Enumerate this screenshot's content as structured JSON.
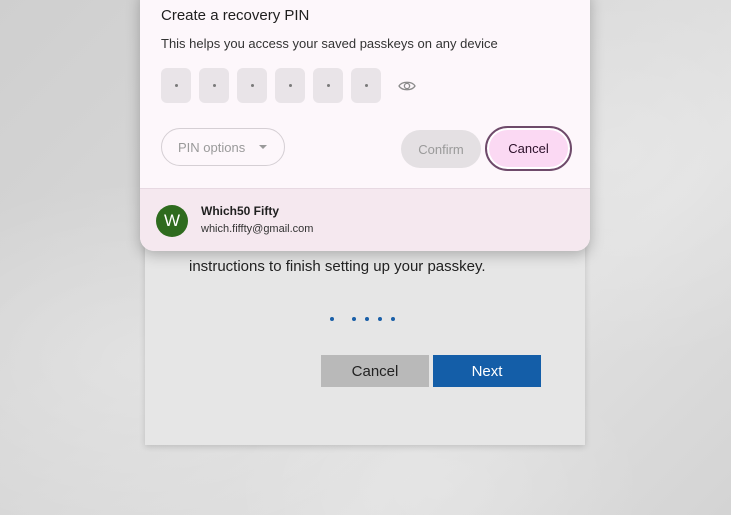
{
  "background": {
    "instructions": "instructions to finish setting up your passkey.",
    "cancel_label": "Cancel",
    "next_label": "Next",
    "progress_dots": 5
  },
  "dialog": {
    "title": "Create a recovery PIN",
    "subtitle": "This helps you access your saved passkeys on any device",
    "pin_slots": 6,
    "pin_options_label": "PIN options",
    "confirm_label": "Confirm",
    "cancel_label": "Cancel",
    "account": {
      "avatar_initial": "W",
      "name": "Which50 Fifty",
      "email": "which.fiffty@gmail.com",
      "avatar_color": "#2e6b1e"
    },
    "icons": {
      "visibility": "eye-icon",
      "dropdown": "chevron-down-icon"
    }
  }
}
